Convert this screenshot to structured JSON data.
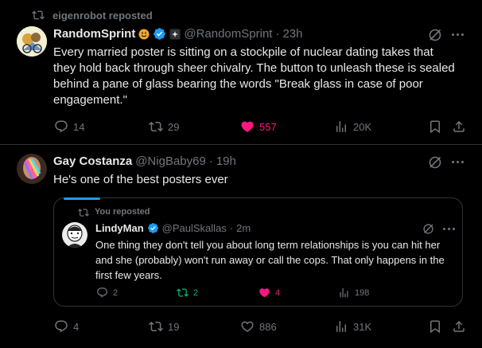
{
  "repost_header": {
    "text": "eigenrobot reposted"
  },
  "tweet1": {
    "author_name": "RandomSprint",
    "handle": "@RandomSprint",
    "separator": "·",
    "time": "23h",
    "text": "Every married poster is sitting on a stockpile of nuclear dating takes that they hold back through sheer chivalry. The button to unleash these is sealed behind a pane of glass bearing the words \"Break glass in case of poor engagement.\"",
    "stats": {
      "replies": "14",
      "reposts": "29",
      "likes": "557",
      "views": "20K"
    }
  },
  "tweet2": {
    "author_name": "Gay Costanza",
    "handle": "@NigBaby69",
    "separator": "·",
    "time": "19h",
    "text": "He's one of the best posters ever",
    "quote": {
      "repost_label": "You reposted",
      "author_name": "LindyMan",
      "handle": "@PaulSkallas",
      "separator": "·",
      "time": "2m",
      "text": "One thing they don't tell you about long term relationships is you can hit her and she (probably) won't run away or call the cops. That only happens in the first few years.",
      "stats": {
        "replies": "2",
        "reposts": "2",
        "likes": "4",
        "views": "198"
      }
    },
    "stats": {
      "replies": "4",
      "reposts": "19",
      "likes": "886",
      "views": "31K"
    }
  },
  "colors": {
    "background": "#000000",
    "text": "#e7e9ea",
    "muted": "#71767b",
    "like_active": "#f91880",
    "repost_active": "#00ba7c",
    "verified": "#1d9bf0",
    "divider": "#2f3336"
  },
  "icons": [
    "repost-icon",
    "verified-badge-icon",
    "grok-icon",
    "more-icon",
    "reply-icon",
    "like-icon",
    "views-icon",
    "bookmark-icon",
    "share-icon"
  ]
}
